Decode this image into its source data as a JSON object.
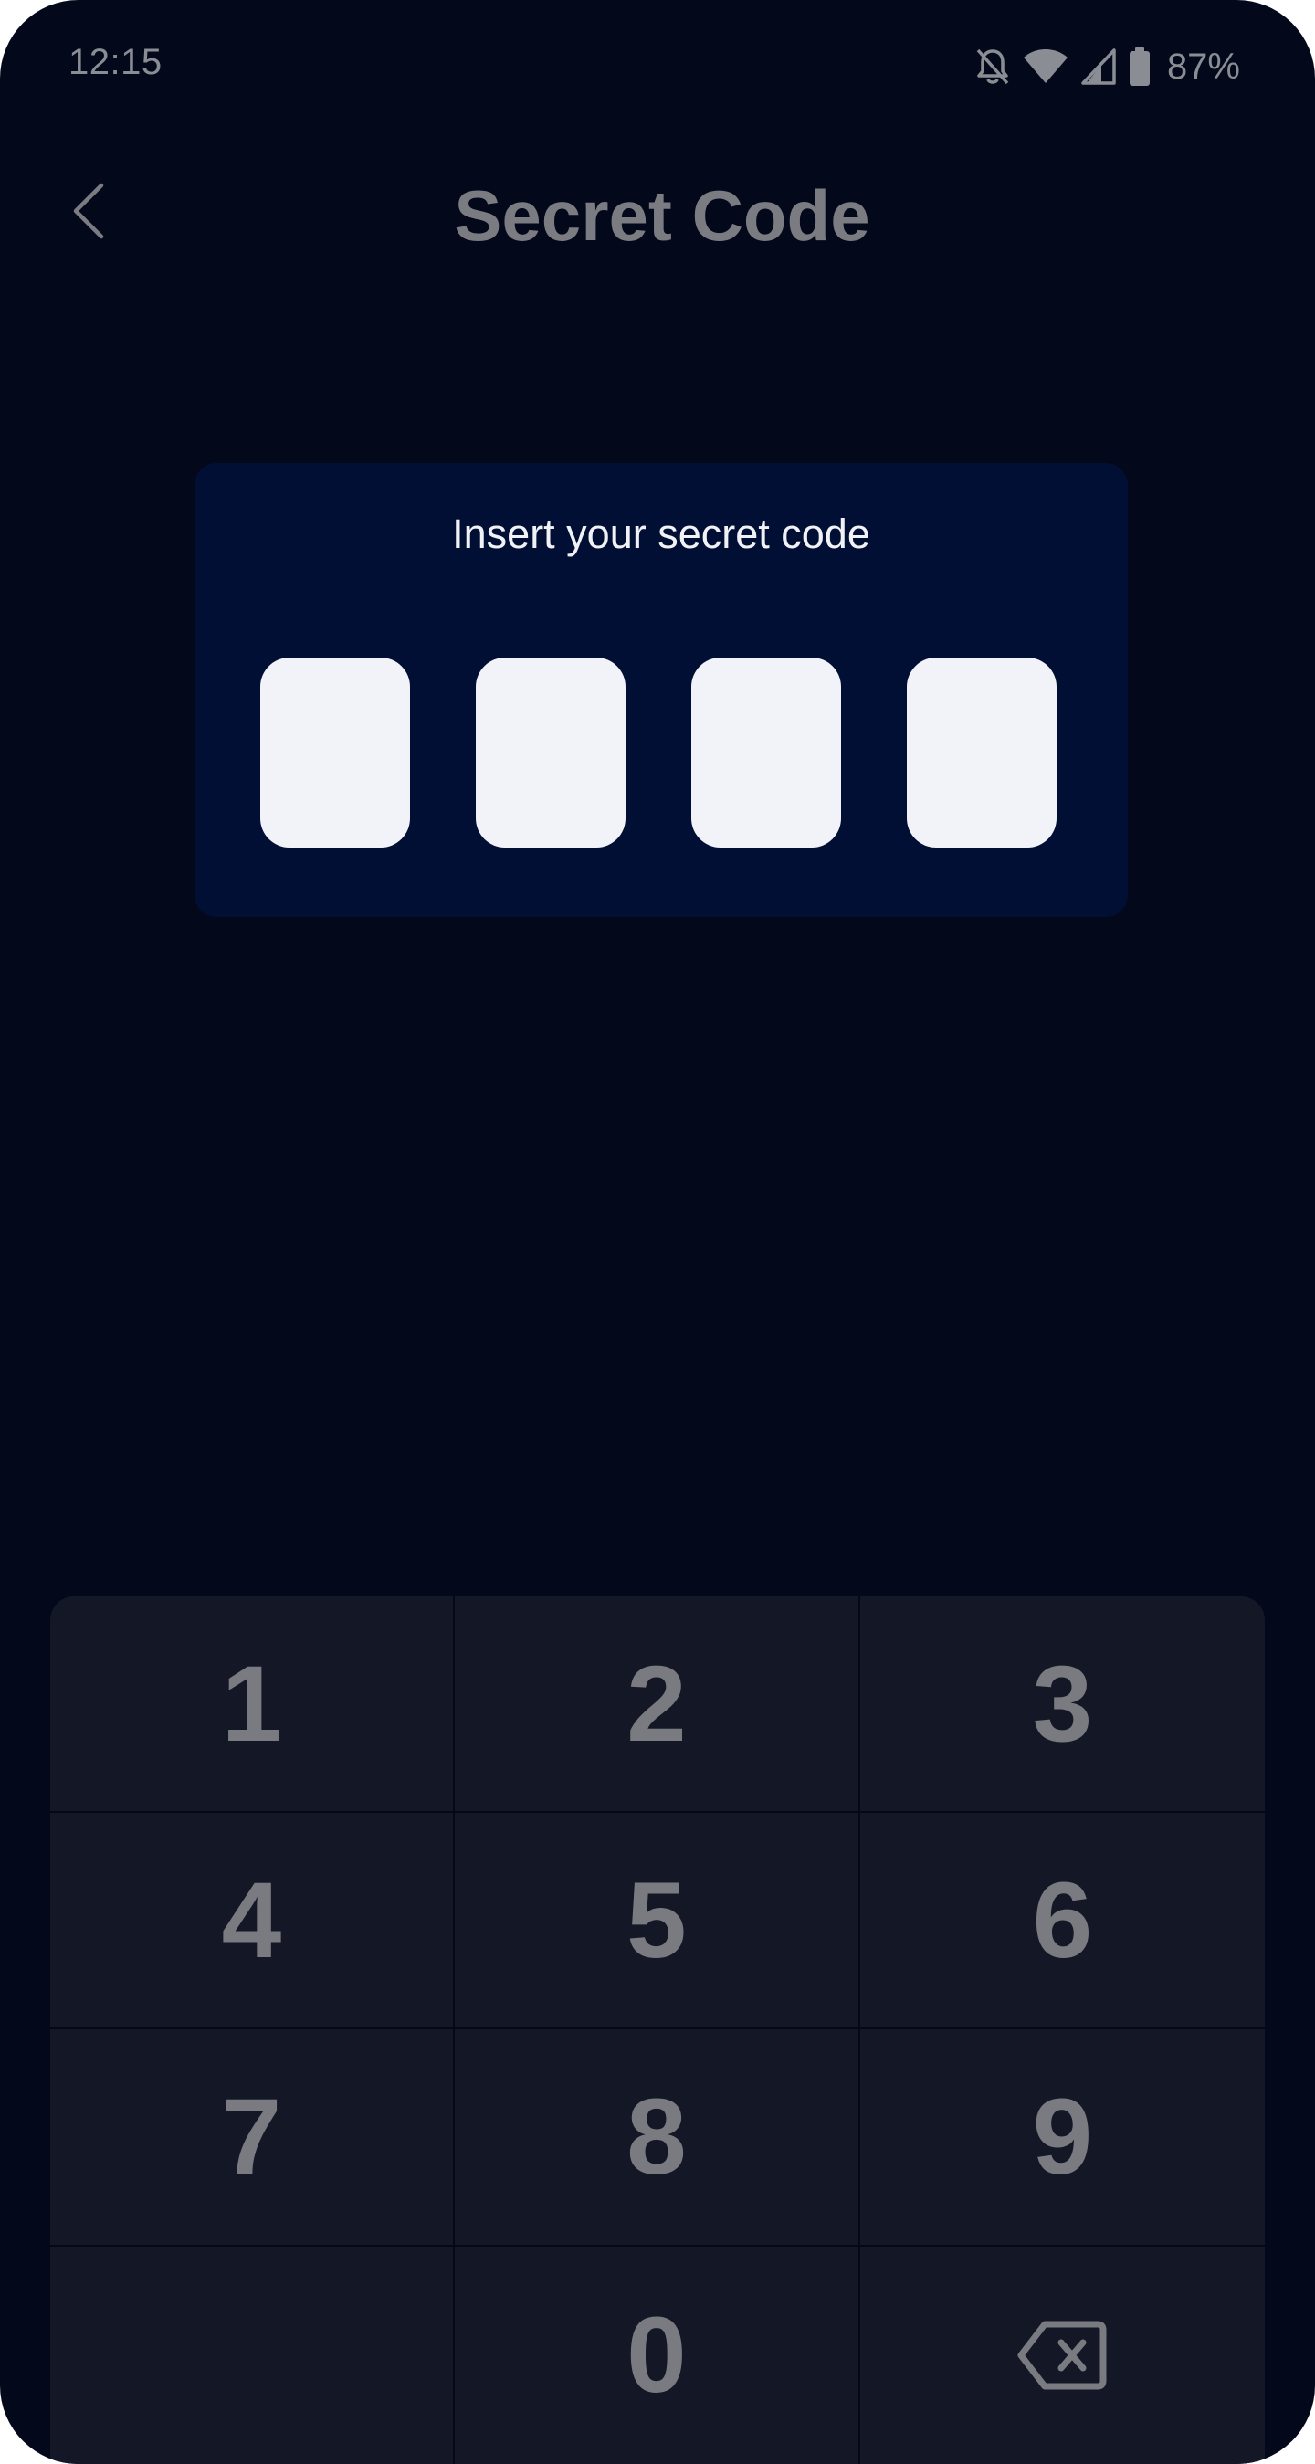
{
  "status_bar": {
    "time": "12:15",
    "battery": "87%",
    "icons": [
      "notifications-off-icon",
      "wifi-icon",
      "cell-signal-icon",
      "battery-icon"
    ]
  },
  "header": {
    "title": "Secret Code",
    "back_icon": "chevron-left-icon"
  },
  "code_entry": {
    "prompt": "Insert your secret code",
    "slots": [
      "",
      "",
      "",
      ""
    ]
  },
  "keypad": {
    "keys": [
      "1",
      "2",
      "3",
      "4",
      "5",
      "6",
      "7",
      "8",
      "9",
      "",
      "0",
      "backspace"
    ],
    "backspace_icon": "backspace-icon"
  },
  "colors": {
    "background": "#03081a",
    "card": "#020f35",
    "slot": "#f2f3f8",
    "keypad": "#141826",
    "muted_text": "#7a7b80"
  }
}
